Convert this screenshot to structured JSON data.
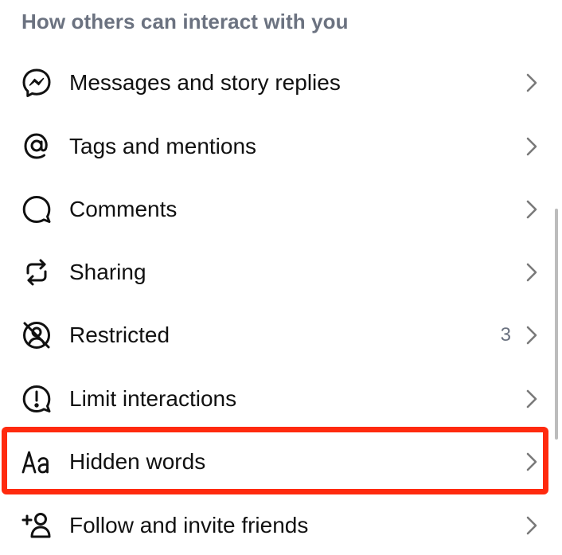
{
  "section": {
    "title": "How others can interact with you"
  },
  "items": [
    {
      "label": "Messages and story replies",
      "icon": "messenger-icon"
    },
    {
      "label": "Tags and mentions",
      "icon": "at-sign-icon"
    },
    {
      "label": "Comments",
      "icon": "comment-bubble-icon"
    },
    {
      "label": "Sharing",
      "icon": "repost-icon"
    },
    {
      "label": "Restricted",
      "icon": "restricted-icon",
      "count": "3"
    },
    {
      "label": "Limit interactions",
      "icon": "alert-circle-icon"
    },
    {
      "label": "Hidden words",
      "icon": "text-aa-icon",
      "highlighted": true
    },
    {
      "label": "Follow and invite friends",
      "icon": "add-person-icon"
    }
  ],
  "colors": {
    "highlight": "#ff2a0e",
    "header_text": "#6b7280",
    "item_text": "#111111",
    "chevron": "#7a7a7a"
  }
}
